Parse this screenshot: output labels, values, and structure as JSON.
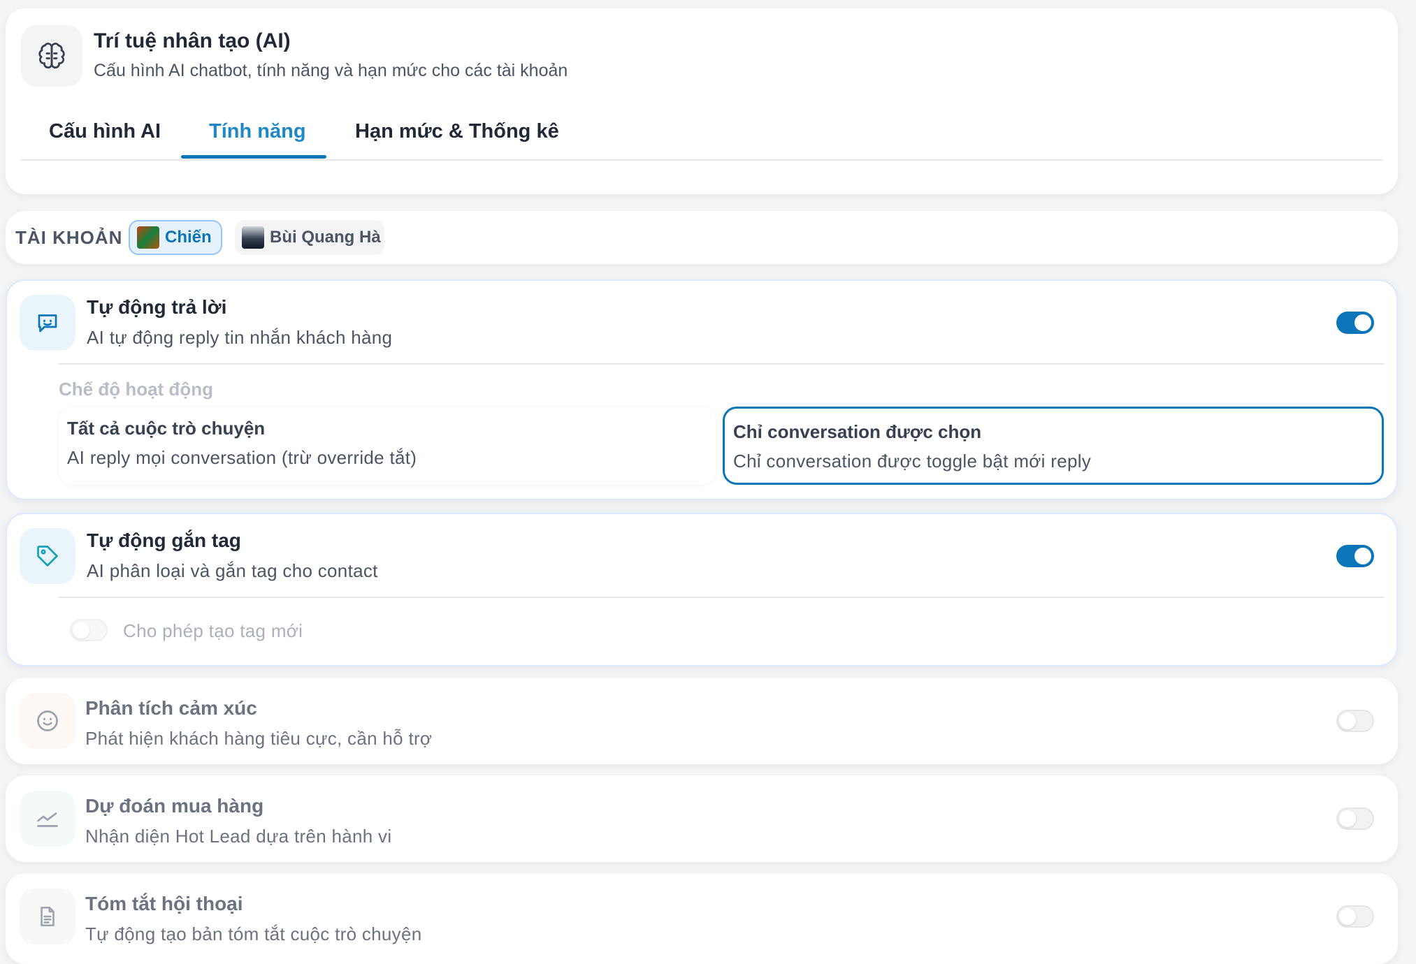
{
  "header": {
    "title": "Trí tuệ nhân tạo (AI)",
    "subtitle": "Cấu hình AI chatbot, tính năng và hạn mức cho các tài khoản",
    "icon": "brain-icon"
  },
  "tabs": [
    {
      "label": "Cấu hình AI",
      "active": false
    },
    {
      "label": "Tính năng",
      "active": true
    },
    {
      "label": "Hạn mức & Thống kê",
      "active": false
    }
  ],
  "accounts": {
    "label": "TÀI KHOẢN",
    "items": [
      {
        "name": "Chiến",
        "selected": true
      },
      {
        "name": "Bùi Quang Hà",
        "selected": false
      }
    ]
  },
  "features": {
    "auto_reply": {
      "title": "Tự động trả lời",
      "desc": "AI tự động reply tin nhắn khách hàng",
      "enabled": true,
      "icon": "chat-smile-icon",
      "mode_label": "Chế độ hoạt động",
      "modes": [
        {
          "title": "Tất cả cuộc trò chuyện",
          "desc": "AI reply mọi conversation (trừ override tắt)",
          "selected": false
        },
        {
          "title": "Chỉ conversation được chọn",
          "desc": "Chỉ conversation được toggle bật mới reply",
          "selected": true
        }
      ]
    },
    "auto_tag": {
      "title": "Tự động gắn tag",
      "desc": "AI phân loại và gắn tag cho contact",
      "enabled": true,
      "icon": "tag-icon",
      "allow_new_tag_label": "Cho phép tạo tag mới",
      "allow_new_tag": false
    },
    "sentiment": {
      "title": "Phân tích cảm xúc",
      "desc": "Phát hiện khách hàng tiêu cực, cần hỗ trợ",
      "enabled": false,
      "icon": "smile-face-icon"
    },
    "purchase_prediction": {
      "title": "Dự đoán mua hàng",
      "desc": "Nhận diện Hot Lead dựa trên hành vi",
      "enabled": false,
      "icon": "trend-chart-icon"
    },
    "summary": {
      "title": "Tóm tắt hội thoại",
      "desc": "Tự động tạo bản tóm tắt cuộc trò chuyện",
      "enabled": false,
      "icon": "document-icon"
    }
  },
  "colors": {
    "accent": "#0a75b8",
    "active_tab": "#1e88c7",
    "chip_bg": "#e6f2fb"
  }
}
